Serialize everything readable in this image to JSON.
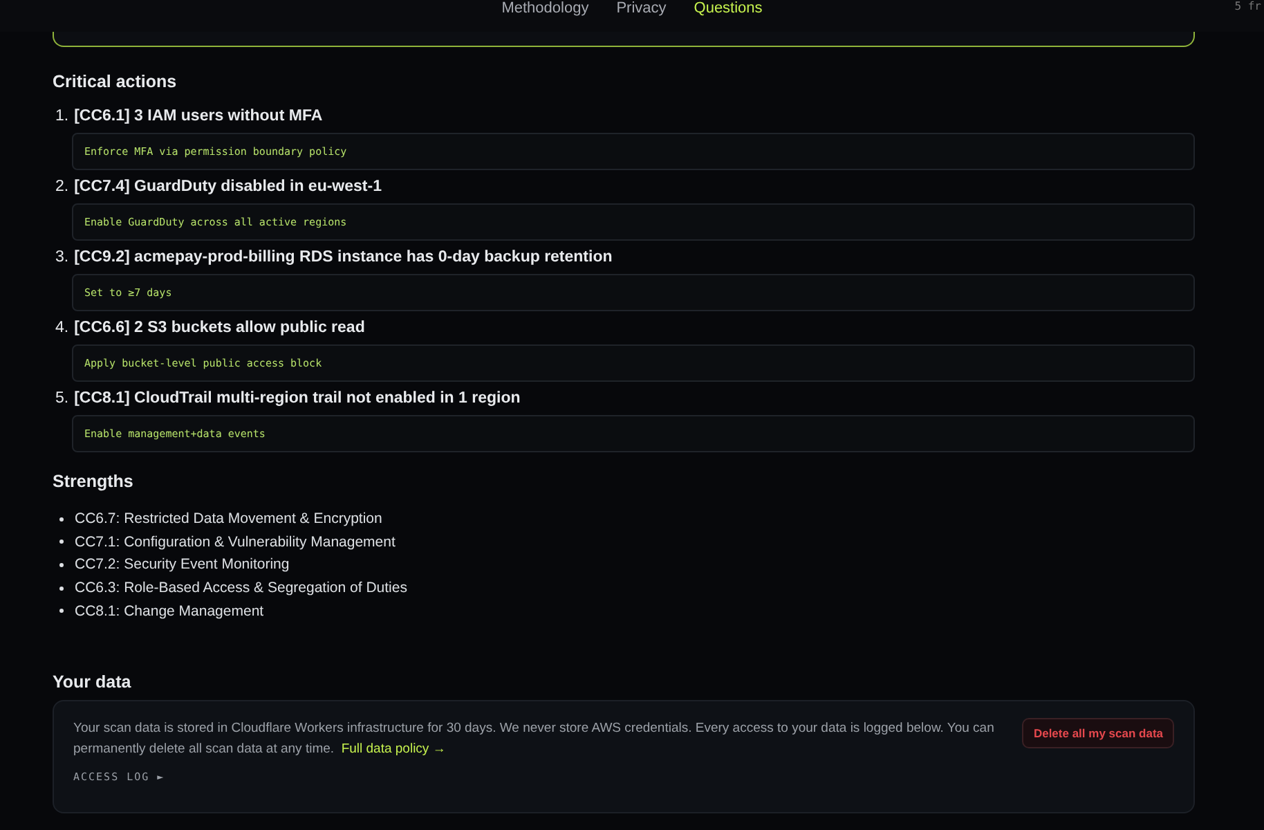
{
  "nav": {
    "links": [
      {
        "label": "Methodology",
        "selected": false
      },
      {
        "label": "Privacy",
        "selected": false
      },
      {
        "label": "Questions",
        "selected": true
      }
    ],
    "corner_text": "5 fr"
  },
  "critical_actions": {
    "title": "Critical actions",
    "items": [
      {
        "number": "1.",
        "title": "[CC6.1] 3 IAM users without MFA",
        "fix": "Enforce MFA via permission boundary policy"
      },
      {
        "number": "2.",
        "title": "[CC7.4] GuardDuty disabled in eu-west-1",
        "fix": "Enable GuardDuty across all active regions"
      },
      {
        "number": "3.",
        "title": "[CC9.2] acmepay-prod-billing RDS instance has 0-day backup retention",
        "fix": "Set to ≥7 days"
      },
      {
        "number": "4.",
        "title": "[CC6.6] 2 S3 buckets allow public read",
        "fix": "Apply bucket-level public access block"
      },
      {
        "number": "5.",
        "title": "[CC8.1] CloudTrail multi-region trail not enabled in 1 region",
        "fix": "Enable management+data events"
      }
    ]
  },
  "strengths": {
    "title": "Strengths",
    "items": [
      "CC6.7: Restricted Data Movement & Encryption",
      "CC7.1: Configuration & Vulnerability Management",
      "CC7.2: Security Event Monitoring",
      "CC6.3: Role-Based Access & Segregation of Duties",
      "CC8.1: Change Management"
    ]
  },
  "your_data": {
    "title": "Your data",
    "text": "Your scan data is stored in Cloudflare Workers infrastructure for 30 days. We never store AWS credentials. Every access to your data is logged below. You can permanently delete all scan data at any time.",
    "policy_link": "Full data policy →",
    "access_log": "ACCESS LOG ►",
    "delete_button": "Delete all my scan data"
  }
}
